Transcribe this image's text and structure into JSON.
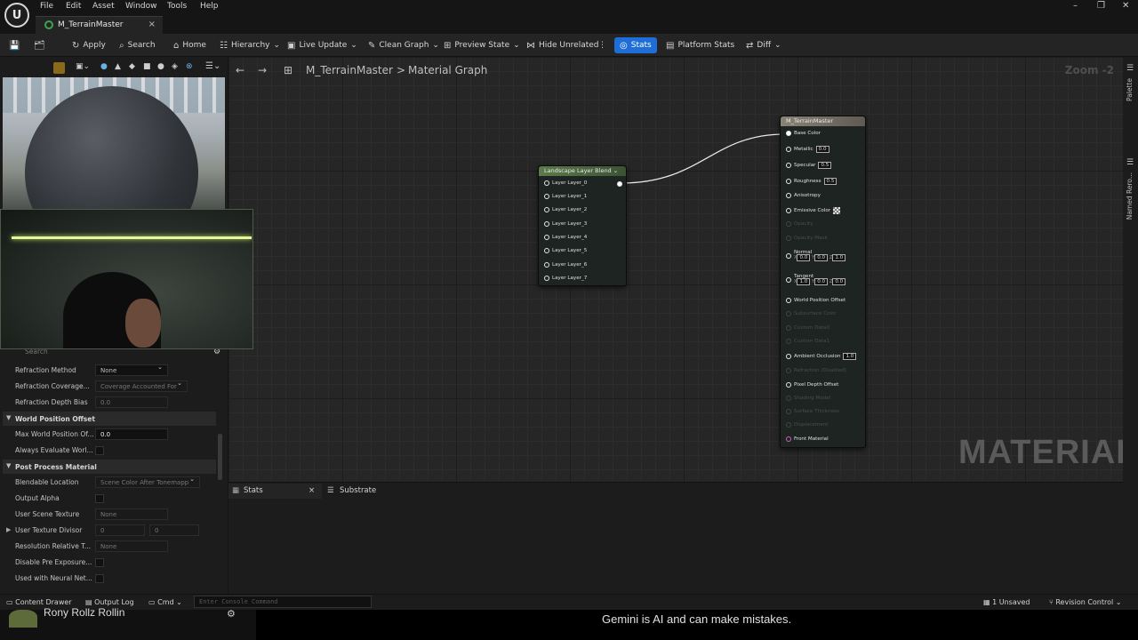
{
  "menu": [
    "File",
    "Edit",
    "Asset",
    "Window",
    "Tools",
    "Help"
  ],
  "window_controls": {
    "minimize": "–",
    "maximize": "❐",
    "close": "✕"
  },
  "tab": {
    "title": "M_TerrainMaster",
    "close": "×"
  },
  "toolbar": {
    "apply": "Apply",
    "search": "Search",
    "home": "Home",
    "hierarchy": "Hierarchy",
    "live_update": "Live Update",
    "clean_graph": "Clean Graph",
    "preview_state": "Preview State",
    "hide_unrelated": "Hide Unrelated",
    "stats": "Stats",
    "platform_stats": "Platform Stats",
    "diff": "Diff"
  },
  "breadcrumb": {
    "asset": "M_TerrainMaster",
    "separator": ">",
    "graph": "Material Graph"
  },
  "zoom": "Zoom -2",
  "watermark": "MATERIAL",
  "side_tabs": {
    "palette": "Palette",
    "named": "Named Rero..."
  },
  "details": {
    "search_placeholder": "Search",
    "refraction_method": {
      "label": "Refraction Method",
      "value": "None"
    },
    "refraction_coverage": {
      "label": "Refraction Coverage...",
      "value": "Coverage Accounted For"
    },
    "refraction_depth_bias": {
      "label": "Refraction Depth Bias",
      "value": "0.0"
    },
    "section_wpo": "World Position Offset",
    "max_wpo": {
      "label": "Max World Position Of...",
      "value": "0.0"
    },
    "always_eval": {
      "label": "Always Evaluate Worl..."
    },
    "section_post": "Post Process Material",
    "blendable_location": {
      "label": "Blendable Location",
      "value": "Scene Color After Tonemapp"
    },
    "output_alpha": {
      "label": "Output Alpha"
    },
    "user_scene_texture": {
      "label": "User Scene Texture",
      "value": "None"
    },
    "user_texture_divisor": {
      "label": "User Texture Divisor",
      "x": "0",
      "y": "0"
    },
    "resolution_relative": {
      "label": "Resolution Relative T...",
      "value": "None"
    },
    "disable_pre_exposure": {
      "label": "Disable Pre Exposure..."
    },
    "used_with_neural": {
      "label": "Used with Neural Net..."
    }
  },
  "layer_node": {
    "title": "Landscape Layer Blend",
    "pins": [
      "Layer Layer_0",
      "Layer Layer_1",
      "Layer Layer_2",
      "Layer Layer_3",
      "Layer Layer_4",
      "Layer Layer_5",
      "Layer Layer_6",
      "Layer Layer_7"
    ]
  },
  "material_node": {
    "title": "M_TerrainMaster",
    "base_color": "Base Color",
    "metallic": {
      "label": "Metallic",
      "value": "0.0"
    },
    "specular": {
      "label": "Specular",
      "value": "0.5"
    },
    "roughness": {
      "label": "Roughness",
      "value": "0.5"
    },
    "anisotropy": "Anisotropy",
    "emissive": "Emissive Color",
    "opacity": "Opacity",
    "opacity_mask": "Opacity Mask",
    "normal": {
      "label": "Normal",
      "x": "0.0",
      "y": "0.0",
      "z": "1.0"
    },
    "tangent": {
      "label": "Tangent",
      "x": "1.0",
      "y": "0.0",
      "z": "0.0"
    },
    "world_position_offset": "World Position Offset",
    "subsurface_color": "Subsurface Color",
    "custom_data0": "Custom Data0",
    "custom_data1": "Custom Data1",
    "ambient_occlusion": {
      "label": "Ambient Occlusion",
      "value": "1.0"
    },
    "refraction": "Refraction (Disabled)",
    "pixel_depth_offset": "Pixel Depth Offset",
    "shading_model": "Shading Model",
    "surface_thickness": "Surface Thickness",
    "displacement": "Displacement",
    "front_material": "Front Material",
    "xyz": {
      "x": "X",
      "y": "Y",
      "z": "Z"
    }
  },
  "bottom_tabs": {
    "stats": "Stats",
    "substrate": "Substrate"
  },
  "statusbar": {
    "content_drawer": "Content Drawer",
    "output_log": "Output Log",
    "cmd": "Cmd",
    "console_placeholder": "Enter Console Command",
    "unsaved": "1 Unsaved",
    "revision_control": "Revision Control"
  },
  "overlay": {
    "names": "Rony   Rollz   Rollin",
    "gemini": "Gemini is AI and can make mistakes."
  }
}
